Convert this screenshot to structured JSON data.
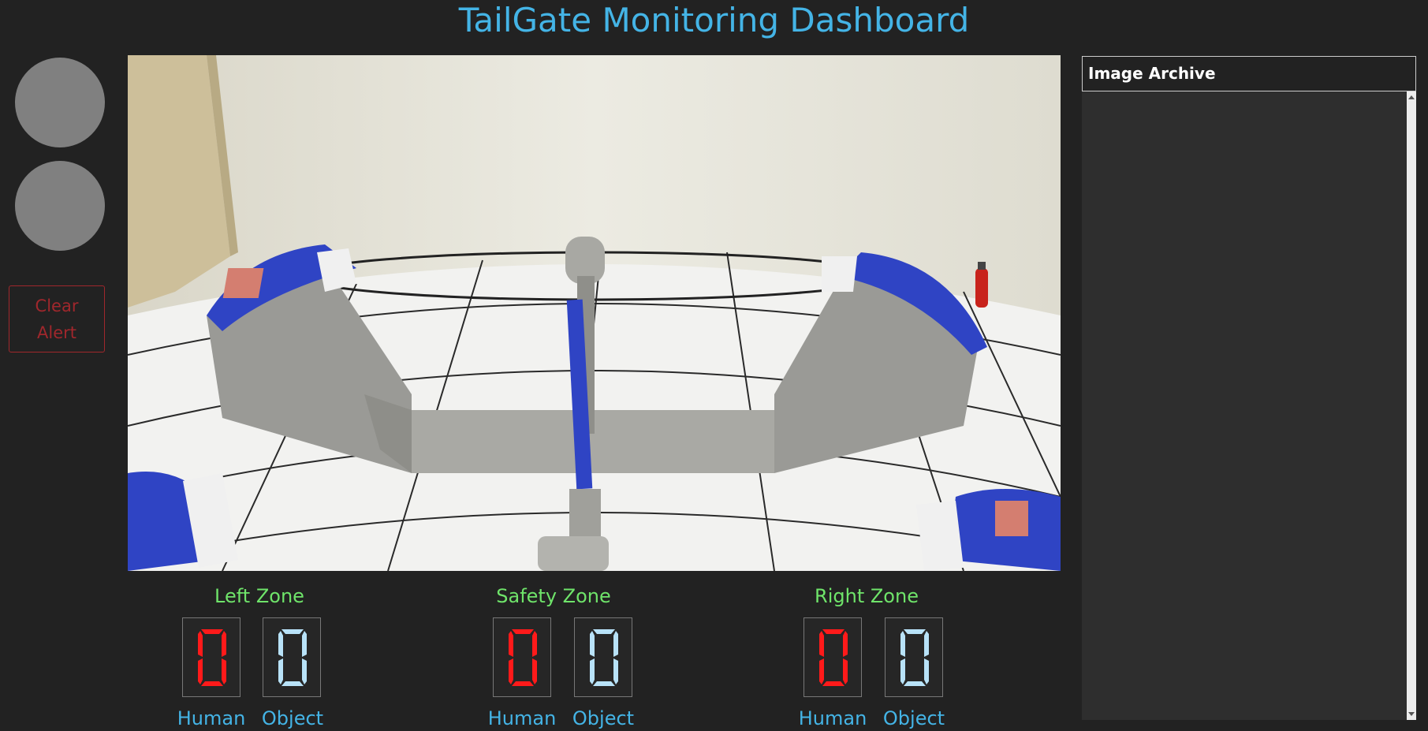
{
  "header": {
    "title": "TailGate Monitoring Dashboard"
  },
  "alerts": {
    "clear_line1": "Clear",
    "clear_line2": "Alert"
  },
  "zones": [
    {
      "title": "Left Zone",
      "human_count": "0",
      "object_count": "0",
      "human_label": "Human",
      "object_label": "Object"
    },
    {
      "title": "Safety Zone",
      "human_count": "0",
      "object_count": "0",
      "human_label": "Human",
      "object_label": "Object"
    },
    {
      "title": "Right Zone",
      "human_count": "0",
      "object_count": "0",
      "human_label": "Human",
      "object_label": "Object"
    }
  ],
  "archive": {
    "title": "Image Archive"
  },
  "colors": {
    "accent_blue": "#44b4e6",
    "zone_green": "#6fe46a",
    "human_digit_red": "#ff1a1a",
    "object_digit_blue": "#b8e2f8",
    "alert_red": "#a0272c"
  }
}
